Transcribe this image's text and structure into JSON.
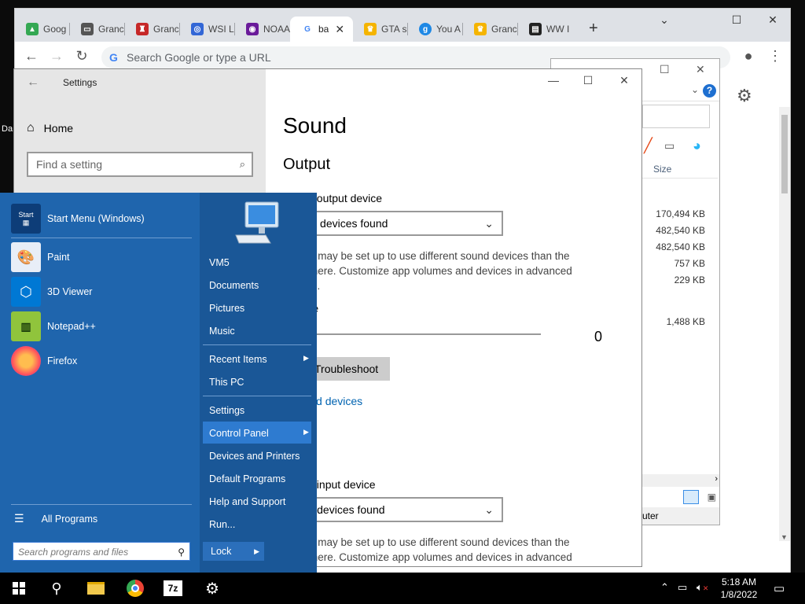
{
  "chrome": {
    "tabs": [
      {
        "title": "Goog",
        "fav_color": "#34a853",
        "fav_glyph": "▲"
      },
      {
        "title": "Granc",
        "fav_color": "#555555",
        "fav_glyph": "▭"
      },
      {
        "title": "Granc",
        "fav_color": "#c62828",
        "fav_glyph": "♜"
      },
      {
        "title": "WSI L",
        "fav_color": "#3367d6",
        "fav_glyph": "◎"
      },
      {
        "title": "NOAA",
        "fav_color": "#6a1b9a",
        "fav_glyph": "◉"
      },
      {
        "title": "ba",
        "fav_color": "#4285f4",
        "fav_glyph": "G"
      },
      {
        "title": "GTA s",
        "fav_color": "#f5b400",
        "fav_glyph": "♛"
      },
      {
        "title": "You A",
        "fav_color": "#1e88e5",
        "fav_glyph": "g"
      },
      {
        "title": "Granc",
        "fav_color": "#f5b400",
        "fav_glyph": "♛"
      },
      {
        "title": "WW I",
        "fav_color": "#222222",
        "fav_glyph": "▤"
      }
    ],
    "omnibox_placeholder": "Search Google or type a URL",
    "omnibox_g": "G"
  },
  "explorer": {
    "help": "?",
    "column_size": "Size",
    "sizes": [
      "170,494 KB",
      "482,540 KB",
      "482,540 KB",
      "757 KB",
      "229 KB",
      "1,488 KB"
    ],
    "bottom_text": "uter"
  },
  "settings": {
    "window_title": "Settings",
    "home_label": "Home",
    "search_placeholder": "Find a setting",
    "page_title": "Sound",
    "output_heading": "Output",
    "output_device_label": "e your output device",
    "output_dropdown": "utput devices found",
    "output_para_1": "n apps may be set up to use different sound devices than the",
    "output_para_2": "ected here. Customize app volumes and devices in advanced",
    "output_para_3": "options.",
    "volume_label": "volume",
    "volume_value": "0",
    "troubleshoot_label": "Troubleshoot",
    "manage_link": "e sound devices",
    "input_heading_fragment": "t",
    "input_device_label": "e your input device",
    "input_dropdown": "nput devices found",
    "input_para_1": "n apps may be set up to use different sound devices than the",
    "input_para_2": "ected here. Customize app volumes and devices in advanced"
  },
  "start_menu": {
    "programs": [
      {
        "label": "Start Menu (Windows)",
        "icon": "start-menu-icon"
      },
      {
        "label": "Paint",
        "icon": "paint-icon"
      },
      {
        "label": "3D Viewer",
        "icon": "3d-viewer-icon"
      },
      {
        "label": "Notepad++",
        "icon": "notepad-plus-plus-icon"
      },
      {
        "label": "Firefox",
        "icon": "firefox-icon"
      }
    ],
    "all_programs": "All Programs",
    "search_placeholder": "Search programs and files",
    "right_links": [
      "VM5",
      "Documents",
      "Pictures",
      "Music",
      "Recent Items",
      "This PC",
      "Settings",
      "Control Panel",
      "Devices and Printers",
      "Default Programs",
      "Help and Support",
      "Run..."
    ],
    "lock_label": "Lock"
  },
  "taskbar": {
    "time": "5:18 AM",
    "date": "1/8/2022",
    "seven_zip": "7z"
  },
  "desktop_label": "Da"
}
